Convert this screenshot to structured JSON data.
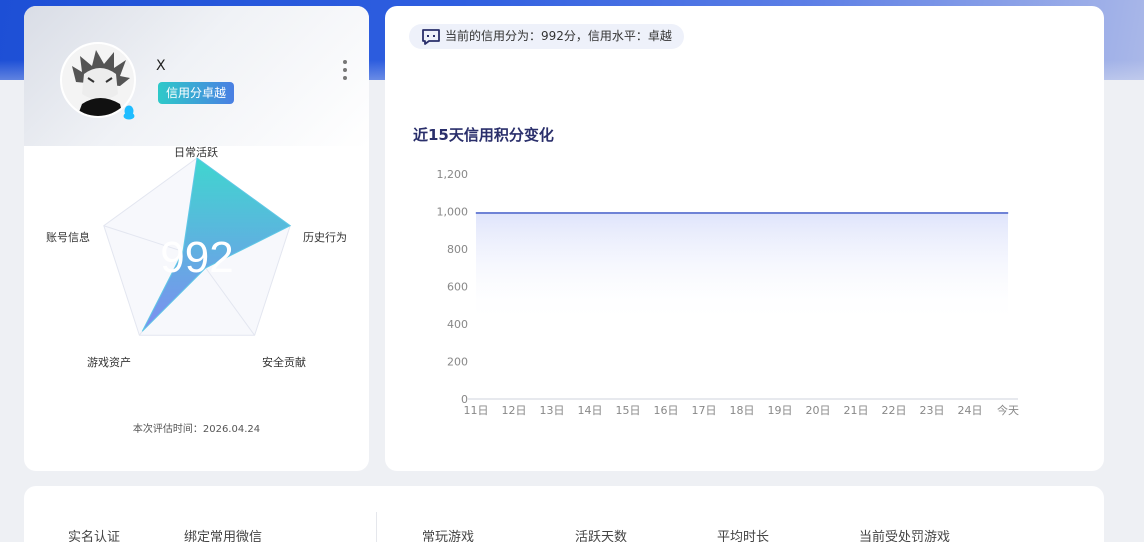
{
  "profile": {
    "username": "X",
    "badge": "信用分卓越",
    "score": "992",
    "eval_time": "本次评估时间：2026.04.24",
    "avatar_icon": "anime-avatar",
    "online_icon": "qq-penguin-icon",
    "menu_icon": "more-vertical-icon"
  },
  "radar": {
    "axes": [
      "日常活跃",
      "历史行为",
      "安全贡献",
      "游戏资产",
      "账号信息"
    ],
    "values": [
      1.0,
      1.0,
      0.15,
      0.95,
      0.15
    ],
    "max": 1
  },
  "header": {
    "summary": "当前的信用分为：992分，信用水平：卓越"
  },
  "chart_title": "近15天信用积分变化",
  "chart_data": {
    "type": "area",
    "title": "近15天信用积分变化",
    "categories": [
      "11日",
      "12日",
      "13日",
      "14日",
      "15日",
      "16日",
      "17日",
      "18日",
      "19日",
      "20日",
      "21日",
      "22日",
      "23日",
      "24日",
      "今天"
    ],
    "series": [
      {
        "values": [
          992,
          992,
          992,
          992,
          992,
          992,
          992,
          992,
          992,
          992,
          992,
          992,
          992,
          992,
          992
        ]
      }
    ],
    "yticks": [
      "0",
      "200",
      "400",
      "600",
      "800",
      "1,000",
      "1,200"
    ],
    "ylim": [
      0,
      1200
    ],
    "xlabel": "",
    "ylabel": "",
    "grid": false,
    "colors": {
      "line": "#6f83d6",
      "fill_top": "#dfe4fb"
    }
  },
  "bottom": {
    "labels": [
      "实名认证",
      "绑定常用微信",
      "常玩游戏",
      "活跃天数",
      "平均时长",
      "当前受处罚游戏"
    ]
  }
}
